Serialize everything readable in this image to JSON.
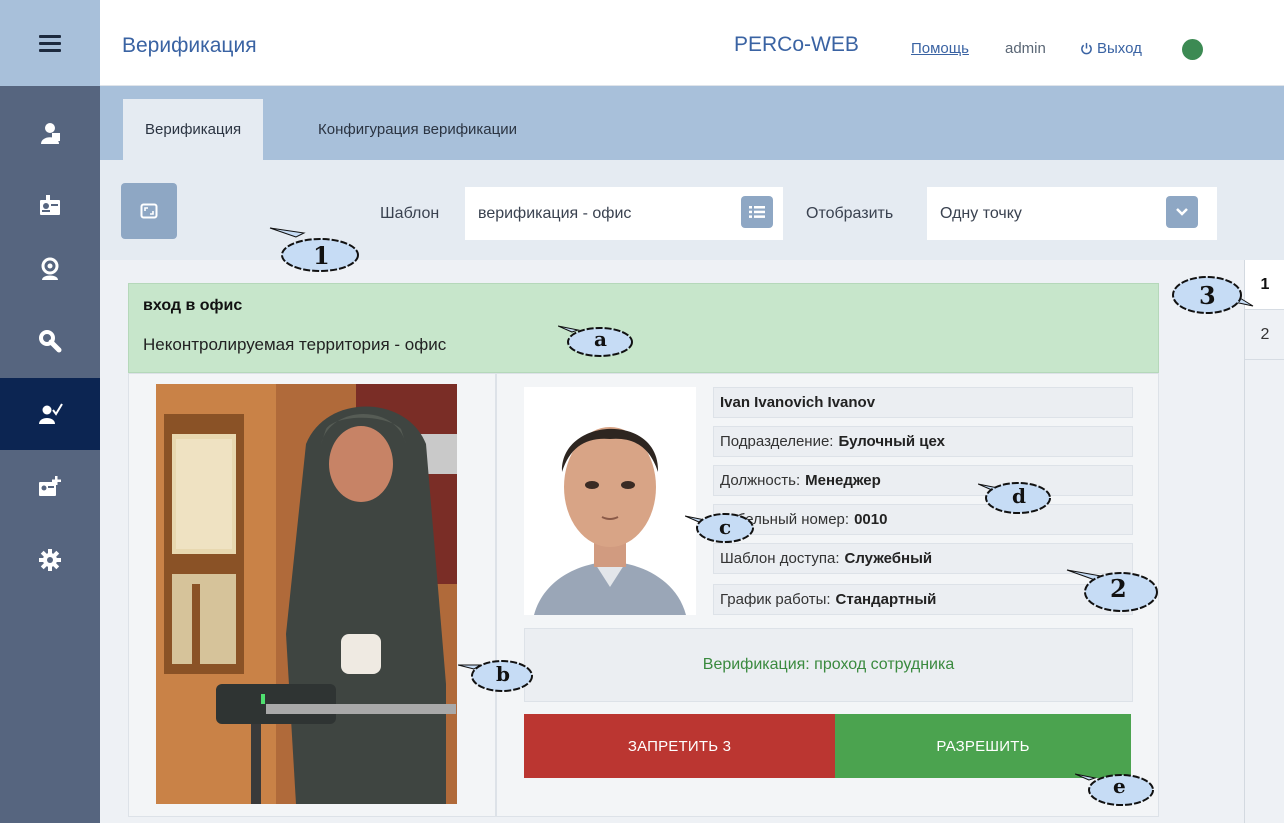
{
  "header": {
    "title": "Верификация",
    "brand": "PERCo-WEB",
    "help": "Помощь",
    "user": "admin",
    "logout": "Выход",
    "status_color": "#3c8a53"
  },
  "sidebar": {
    "items": [
      {
        "icon": "menu-icon"
      },
      {
        "icon": "staff-icon"
      },
      {
        "icon": "id-card-icon"
      },
      {
        "icon": "monitoring-icon"
      },
      {
        "icon": "search-icon"
      },
      {
        "icon": "verification-icon",
        "active": true
      },
      {
        "icon": "add-badge-icon"
      },
      {
        "icon": "settings-icon"
      }
    ],
    "active_color": "#0c2552"
  },
  "tabs": [
    {
      "label": "Верификация",
      "active": true
    },
    {
      "label": "Конфигурация верификации",
      "active": false
    }
  ],
  "toolbar": {
    "template_label": "Шаблон",
    "template_value": "верификация - офис",
    "display_label": "Отобразить",
    "display_value": "Одну точку"
  },
  "event": {
    "title": "вход в офис",
    "zone": "Неконтролируемая территория - офис"
  },
  "employee": {
    "name": "Ivan Ivanovich Ivanov",
    "department_label": "Подразделение:",
    "department": "Булочный цех",
    "position_label": "Должность:",
    "position": "Менеджер",
    "tab_number_label": "Табельный номер:",
    "tab_number": "0010",
    "access_label": "Шаблон доступа:",
    "access": "Служебный",
    "schedule_label": "График работы:",
    "schedule": "Стандартный"
  },
  "verification_message": "Верификация: проход сотрудника",
  "buttons": {
    "deny": "ЗАПРЕТИТЬ 3",
    "allow": "РАЗРЕШИТЬ"
  },
  "pages": [
    "1",
    "2"
  ],
  "callouts": [
    "1",
    "2",
    "3",
    "a",
    "b",
    "c",
    "d",
    "e"
  ]
}
